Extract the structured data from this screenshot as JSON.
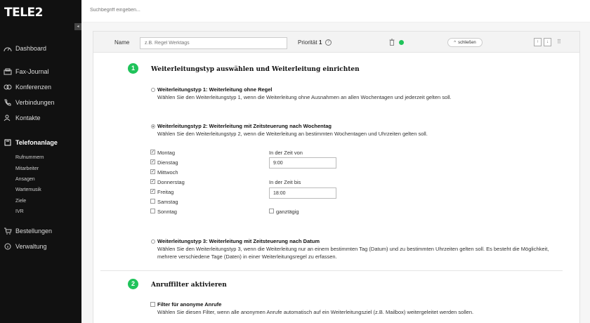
{
  "brand": {
    "logo_text": "TELE2",
    "accent_color": "#1fc35a"
  },
  "search": {
    "placeholder": "Suchbegriff eingeben..."
  },
  "sidebar": {
    "collapse_icon": "triangle-left-icon",
    "items": [
      {
        "label": "Dashboard",
        "icon": "speedometer-icon"
      },
      {
        "label": "Fax-Journal",
        "icon": "fax-icon"
      },
      {
        "label": "Konferenzen",
        "icon": "conference-icon"
      },
      {
        "label": "Verbindungen",
        "icon": "phone-icon"
      },
      {
        "label": "Kontakte",
        "icon": "contacts-icon"
      },
      {
        "label": "Telefonanlage",
        "icon": "telephone-system-icon",
        "active": true
      },
      {
        "label": "Bestellungen",
        "icon": "cart-icon"
      },
      {
        "label": "Verwaltung",
        "icon": "info-icon"
      }
    ],
    "subitems": [
      "Rufnummern",
      "Mitarbeiter",
      "Ansagen",
      "Wartemusik",
      "Ziele",
      "IVR"
    ]
  },
  "rule": {
    "name_label": "Name",
    "name_placeholder": "z.B. Regel Werktags",
    "priority_label": "Priorität",
    "priority_value": "1",
    "help_glyph": "?",
    "close_label": "schließen",
    "close_chevron": "^",
    "up_glyph": "↑",
    "down_glyph": "↓",
    "drag_glyph": "⠿"
  },
  "section1": {
    "number": "1",
    "title": "Weiterleitungstyp auswählen und Weiterleitung einrichten",
    "options": [
      {
        "title": "Weiterleitungstyp 1: Weiterleitung ohne Regel",
        "desc": "Wählen Sie den Weiterleitungstyp 1, wenn die Weiterleitung ohne Ausnahmen an allen Wochentagen und jederzeit gelten soll.",
        "selected": false
      },
      {
        "title": "Weiterleitungstyp 2: Weiterleitung mit Zeitsteuerung nach Wochentag",
        "desc": "Wählen Sie den Weiterleitungstyp 2, wenn die Weiterleitung an bestimmten Wochentagen und Uhrzeiten gelten soll.",
        "selected": true
      },
      {
        "title": "Weiterleitungstyp 3: Weiterleitung mit Zeitsteuerung nach Datum",
        "desc_line1": "Wählen Sie den Weiterleitungstyp 3, wenn die Weiterleitung nur an einem bestimmten Tag (Datum) und zu bestimmten Uhrzeiten gelten soll. Es besteht die Möglichkeit,",
        "desc_line2": "mehrere verschiedene Tage (Daten) in einer Weiterleitungsregel zu erfassen.",
        "selected": false
      }
    ],
    "days": [
      {
        "label": "Montag",
        "checked": true
      },
      {
        "label": "Dienstag",
        "checked": true
      },
      {
        "label": "Mittwoch",
        "checked": true
      },
      {
        "label": "Donnerstag",
        "checked": true
      },
      {
        "label": "Freitag",
        "checked": true
      },
      {
        "label": "Samstag",
        "checked": false
      },
      {
        "label": "Sonntag",
        "checked": false
      }
    ],
    "check_glyph": "✓",
    "from_label": "In der Zeit von",
    "from_value": "9:00",
    "to_label": "In der Zeit bis",
    "to_value": "18:00",
    "allday_label": "ganztägig",
    "allday_checked": false
  },
  "section2": {
    "number": "2",
    "title": "Anruffilter aktivieren",
    "filter_title": "Filter für anonyme Anrufe",
    "filter_desc": "Wählen Sie diesen Filter, wenn alle anonymen Anrufe automatisch auf ein Weiterleitungsziel (z.B. Mailbox) weitergeleitet werden sollen.",
    "filter_checked": false
  }
}
